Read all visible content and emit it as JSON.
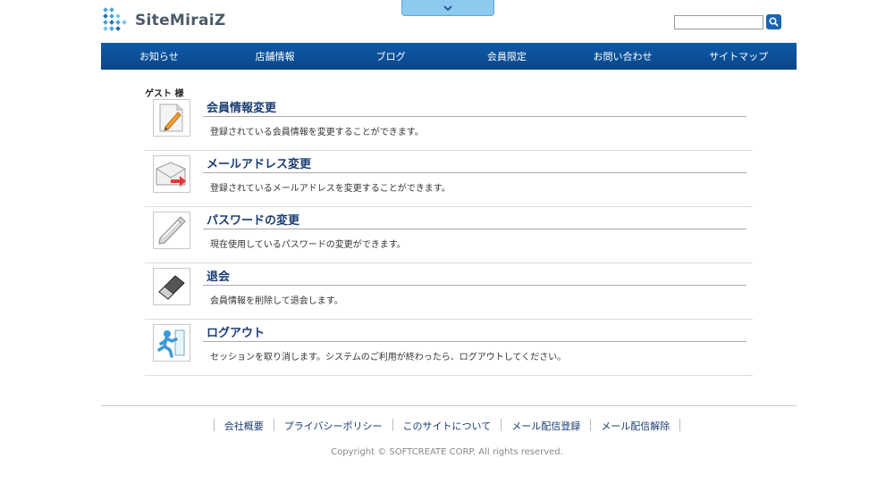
{
  "header": {
    "logo_text": "SiteMiraiZ",
    "search_placeholder": "",
    "search_value": ""
  },
  "nav": {
    "items": [
      "お知らせ",
      "店舗情報",
      "ブログ",
      "会員限定",
      "お問い合わせ",
      "サイトマップ"
    ]
  },
  "user": {
    "greeting": "ゲスト 様"
  },
  "menu": {
    "items": [
      {
        "title": "会員情報変更",
        "desc": "登録されている会員情報を変更することができます。",
        "icon": "edit-document-icon"
      },
      {
        "title": "メールアドレス変更",
        "desc": "登録されているメールアドレスを変更することができます。",
        "icon": "envelope-arrow-icon"
      },
      {
        "title": "パスワードの変更",
        "desc": "現在使用しているパスワードの変更ができます。",
        "icon": "key-icon"
      },
      {
        "title": "退会",
        "desc": "会員情報を削除して退会します。",
        "icon": "eraser-icon"
      },
      {
        "title": "ログアウト",
        "desc": "セッションを取り消します。システムのご利用が終わったら、ログアウトしてください。",
        "icon": "exit-person-icon"
      }
    ]
  },
  "footer": {
    "links": [
      "会社概要",
      "プライバシーポリシー",
      "このサイトについて",
      "メール配信登録",
      "メール配信解除"
    ],
    "copyright": "Copyright © SOFTCREATE CORP. All rights reserved."
  },
  "colors": {
    "nav": "#0d5aa8",
    "title": "#1a3d73",
    "tab": "#8ec9ee"
  }
}
